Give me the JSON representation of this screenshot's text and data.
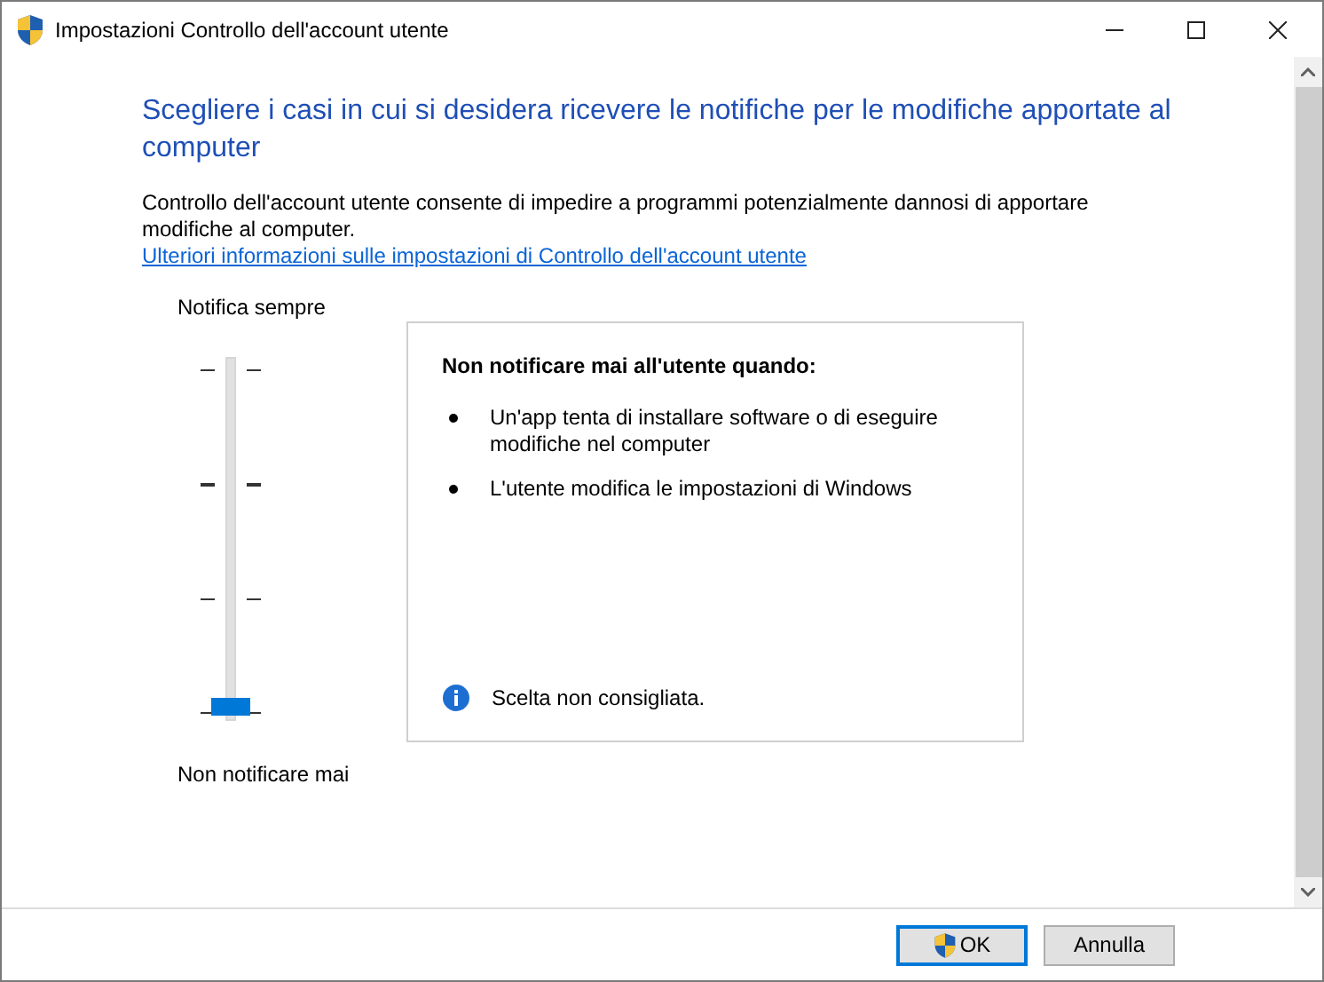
{
  "window": {
    "title": "Impostazioni Controllo dell'account utente"
  },
  "heading": "Scegliere i casi in cui si desidera ricevere le notifiche per le modifiche apportate al computer",
  "description": "Controllo dell'account utente consente di impedire a programmi potenzialmente dannosi di apportare modifiche al computer.",
  "link": "Ulteriori informazioni sulle impostazioni di Controllo dell'account utente",
  "slider": {
    "top_label": "Notifica sempre",
    "bottom_label": "Non notificare mai",
    "level": 0
  },
  "info_box": {
    "title": "Non notificare mai all'utente quando:",
    "bullets": [
      "Un'app tenta di installare software o di eseguire modifiche nel computer",
      "L'utente modifica le impostazioni di Windows"
    ],
    "note": "Scelta non consigliata."
  },
  "buttons": [
    {
      "label": "OK",
      "default": true,
      "shield": true
    },
    {
      "label": "Annulla",
      "default": false,
      "shield": false
    }
  ]
}
